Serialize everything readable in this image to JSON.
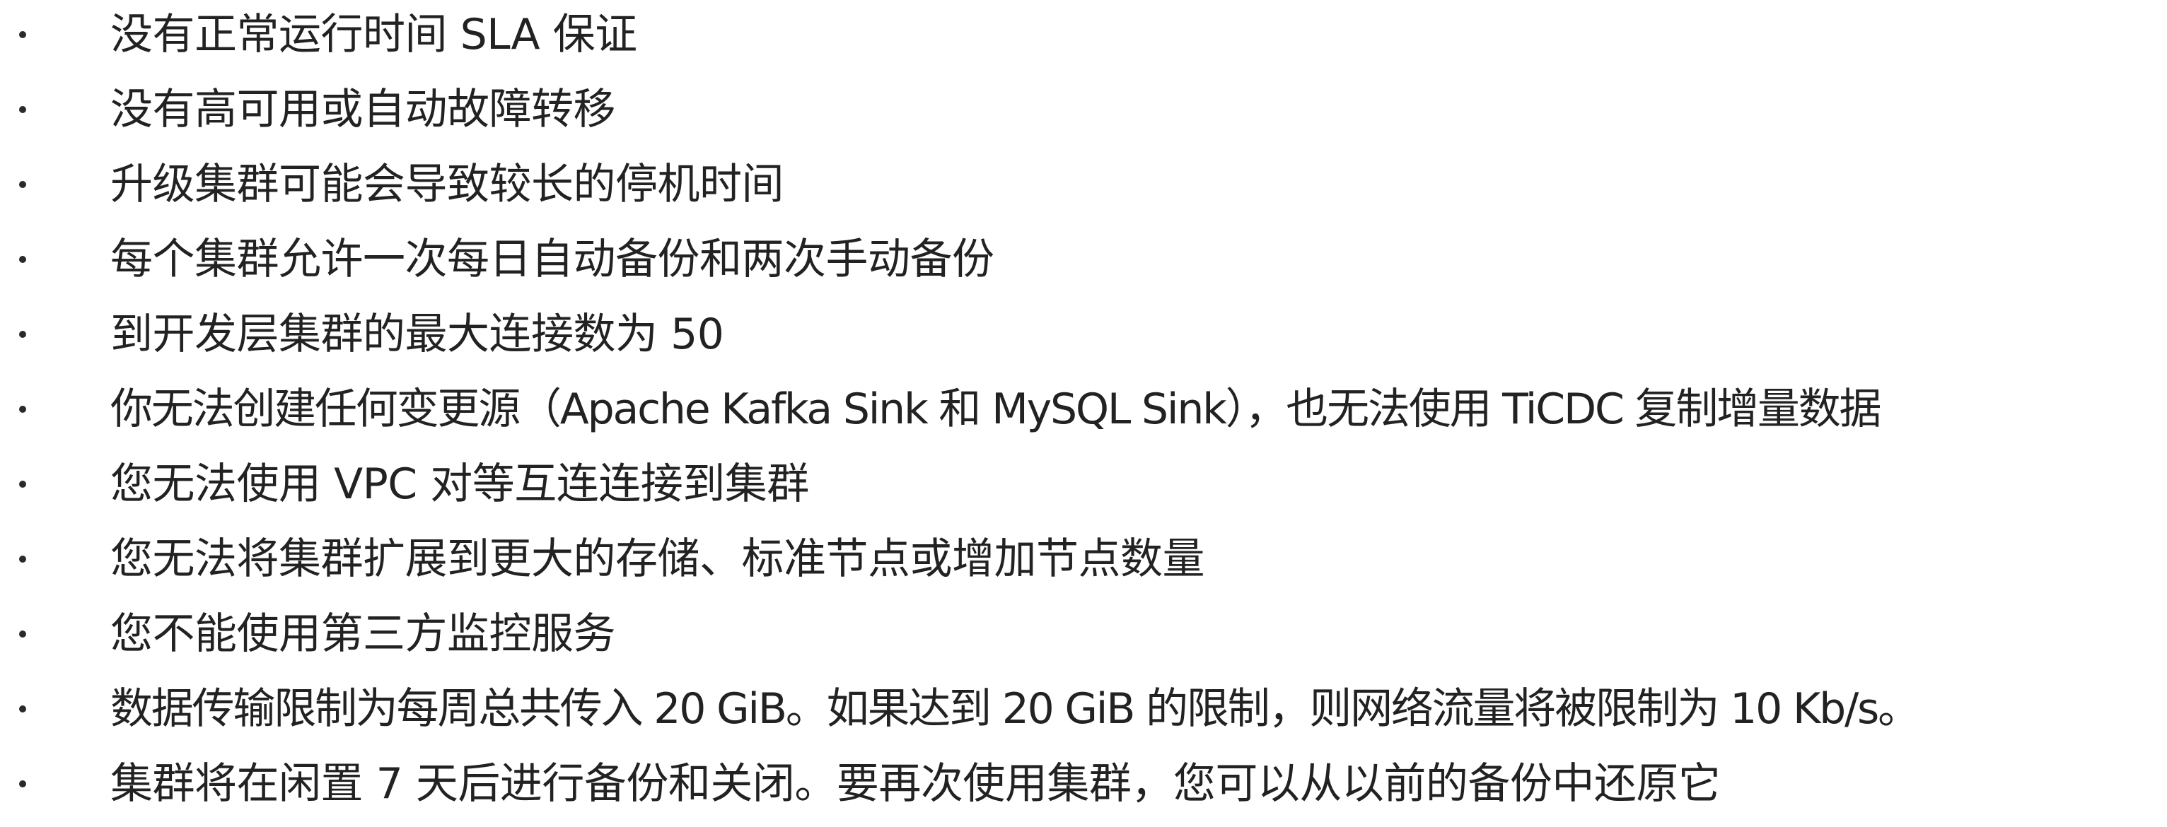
{
  "list": {
    "items": [
      "没有正常运行时间 SLA 保证",
      "没有高可用或自动故障转移",
      "升级集群可能会导致较长的停机时间",
      "每个集群允许一次每日自动备份和两次手动备份",
      "到开发层集群的最大连接数为 50",
      "你无法创建任何变更源（Apache Kafka Sink 和 MySQL Sink），也无法使用 TiCDC 复制增量数据",
      "您无法使用 VPC 对等互连连接到集群",
      "您无法将集群扩展到更大的存储、标准节点或增加节点数量",
      "您不能使用第三方监控服务",
      "数据传输限制为每周总共传入 20 GiB。如果达到 20 GiB 的限制，则网络流量将被限制为 10 Kb/s。",
      "集群将在闲置 7 天后进行备份和关闭。要再次使用集群，您可以从以前的备份中还原它"
    ]
  }
}
